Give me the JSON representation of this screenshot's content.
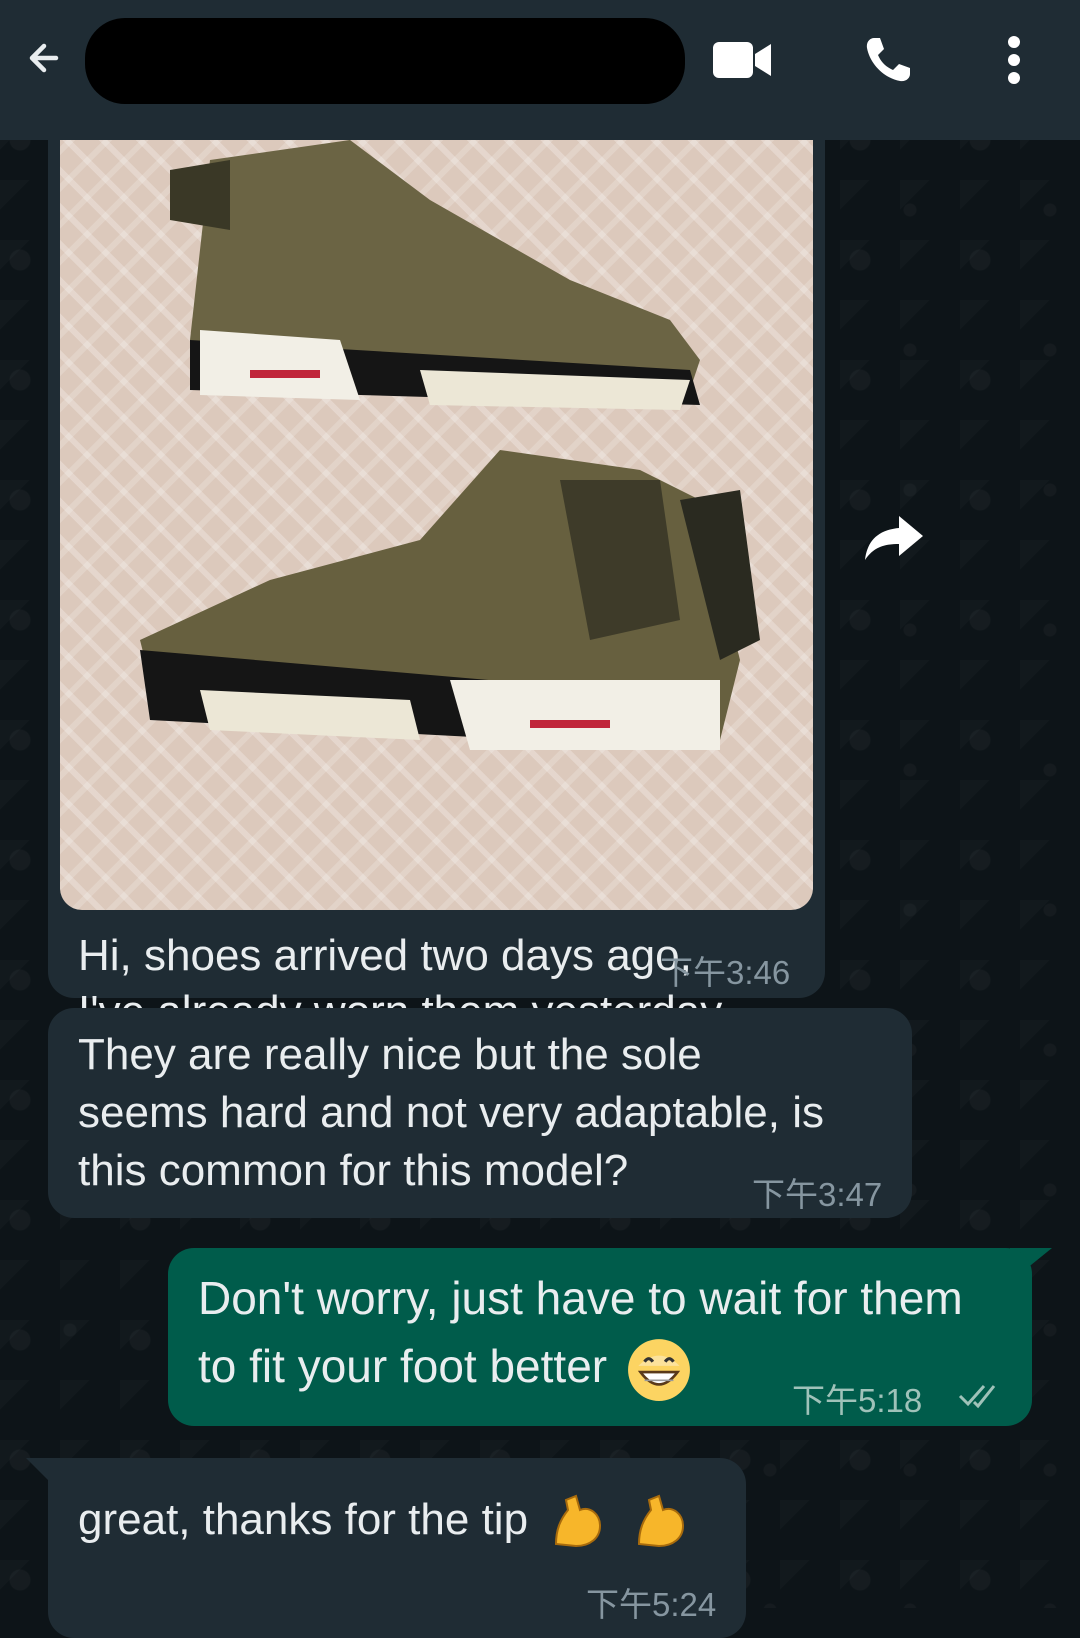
{
  "topbar": {
    "back_icon": "back-arrow-icon",
    "contact_name": "",
    "video_icon": "video-call-icon",
    "call_icon": "phone-icon",
    "menu_icon": "more-vertical-icon"
  },
  "messages": [
    {
      "direction": "in",
      "type": "image",
      "caption": "Hi, shoes arrived two days ago,\nI've already worn them yesterday.",
      "time": "下午3:46"
    },
    {
      "direction": "in",
      "type": "text",
      "text": "They are really nice but the sole\nseems hard and not very adaptable, is\nthis common for this model?",
      "time": "下午3:47"
    },
    {
      "direction": "out",
      "type": "text",
      "text": "Don't worry, just have to wait for them to fit your foot better",
      "emoji": "grinning-face",
      "time": "下午5:18",
      "status": "read"
    },
    {
      "direction": "in",
      "type": "text",
      "text": "great, thanks for the tip",
      "emoji": "flexed-biceps x2",
      "time": "下午5:24"
    }
  ],
  "colors": {
    "header": "#1f2c34",
    "incoming_bubble": "#1f2c34",
    "outgoing_bubble": "#005c4b",
    "background": "#0d1418",
    "text": "#e9edef",
    "timestamp": "#8696a0"
  }
}
